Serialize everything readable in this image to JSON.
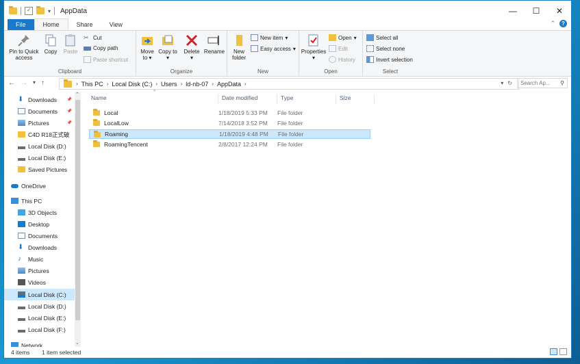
{
  "window": {
    "title": "AppData"
  },
  "tabs": [
    {
      "label": "File"
    },
    {
      "label": "Home"
    },
    {
      "label": "Share"
    },
    {
      "label": "View"
    }
  ],
  "ribbon": {
    "clipboard": {
      "label": "Clipboard",
      "pin": "Pin to Quick access",
      "copy": "Copy",
      "paste": "Paste",
      "cut": "Cut",
      "copy_path": "Copy path",
      "paste_shortcut": "Paste shortcut"
    },
    "organize": {
      "label": "Organize",
      "move_to": "Move to",
      "copy_to": "Copy to",
      "delete": "Delete",
      "rename": "Rename"
    },
    "new": {
      "label": "New",
      "new_folder": "New folder",
      "new_item": "New item",
      "easy_access": "Easy access"
    },
    "open": {
      "label": "Open",
      "properties": "Properties",
      "open": "Open",
      "edit": "Edit",
      "history": "History"
    },
    "select": {
      "label": "Select",
      "select_all": "Select all",
      "select_none": "Select none",
      "invert": "Invert selection"
    }
  },
  "address": {
    "crumbs": [
      "This PC",
      "Local Disk (C:)",
      "Users",
      "ld-nb-07",
      "AppData"
    ],
    "search_placeholder": "Search Ap..."
  },
  "nav": {
    "items": [
      {
        "label": "Downloads",
        "pinned": true,
        "icon": "download-icon"
      },
      {
        "label": "Documents",
        "pinned": true,
        "icon": "document-icon"
      },
      {
        "label": "Pictures",
        "pinned": true,
        "icon": "picture-icon"
      },
      {
        "label": "C4D R18正式破",
        "pinned": false,
        "icon": "folder-icon"
      },
      {
        "label": "Local Disk (D:)",
        "pinned": false,
        "icon": "drive-icon"
      },
      {
        "label": "Local Disk (E:)",
        "pinned": false,
        "icon": "drive-icon"
      },
      {
        "label": "Saved Pictures",
        "pinned": false,
        "icon": "folder-icon"
      },
      {
        "label": "OneDrive",
        "pinned": false,
        "icon": "cloud-icon"
      },
      {
        "label": "This PC",
        "pinned": false,
        "icon": "pc-icon"
      },
      {
        "label": "3D Objects",
        "pinned": false,
        "icon": "cube-icon"
      },
      {
        "label": "Desktop",
        "pinned": false,
        "icon": "desktop-icon"
      },
      {
        "label": "Documents",
        "pinned": false,
        "icon": "document-icon"
      },
      {
        "label": "Downloads",
        "pinned": false,
        "icon": "download-icon"
      },
      {
        "label": "Music",
        "pinned": false,
        "icon": "music-icon"
      },
      {
        "label": "Pictures",
        "pinned": false,
        "icon": "picture-icon"
      },
      {
        "label": "Videos",
        "pinned": false,
        "icon": "video-icon"
      },
      {
        "label": "Local Disk (C:)",
        "pinned": false,
        "icon": "windows-drive-icon",
        "selected": true
      },
      {
        "label": "Local Disk (D:)",
        "pinned": false,
        "icon": "drive-icon"
      },
      {
        "label": "Local Disk (E:)",
        "pinned": false,
        "icon": "drive-icon"
      },
      {
        "label": "Local Disk (F:)",
        "pinned": false,
        "icon": "drive-icon"
      },
      {
        "label": "Network",
        "pinned": false,
        "icon": "network-icon"
      }
    ]
  },
  "files": {
    "columns": [
      "Name",
      "Date modified",
      "Type",
      "Size"
    ],
    "rows": [
      {
        "name": "Local",
        "date": "1/18/2019 5:33 PM",
        "type": "File folder",
        "size": ""
      },
      {
        "name": "LocalLow",
        "date": "7/14/2018 3:52 PM",
        "type": "File folder",
        "size": ""
      },
      {
        "name": "Roaming",
        "date": "1/18/2019 4:48 PM",
        "type": "File folder",
        "size": "",
        "selected": true
      },
      {
        "name": "RoamingTencent",
        "date": "2/8/2017 12:24 PM",
        "type": "File folder",
        "size": ""
      }
    ]
  },
  "status": {
    "count": "4 items",
    "selection": "1 item selected"
  },
  "colors": {
    "accent": "#1979ca",
    "selection": "#cce8ff",
    "folder": "#f0c040"
  }
}
